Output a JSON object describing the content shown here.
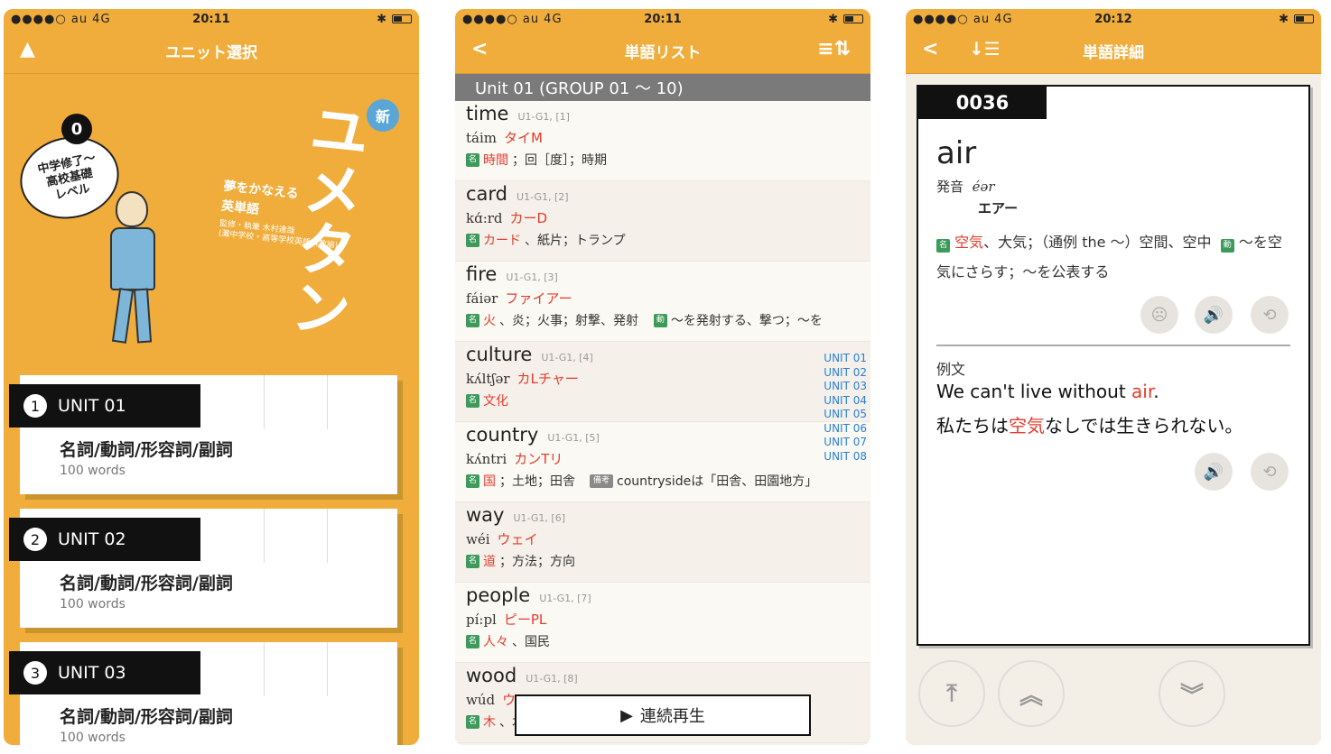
{
  "status": [
    {
      "carrier": "●●●●○ au  4G",
      "time": "20:11"
    },
    {
      "carrier": "●●●●○ au  4G",
      "time": "20:11"
    },
    {
      "carrier": "●●●●○ au  4G",
      "time": "20:12"
    }
  ],
  "screen1": {
    "nav_title": "ユニット選択",
    "bubble_text": "中学修了〜\n高校基礎\nレベル",
    "bubble_num": "0",
    "subtitle": "夢をかなえる\n英単語",
    "credit": "監修・執筆 木村達哉\n(灘中学校・高等学校英語科教諭)",
    "title": "ユメタン",
    "new_badge": "新",
    "units": [
      {
        "num": "1",
        "label": "UNIT 01",
        "title": "名詞/動詞/形容詞/副詞",
        "words": "100 words"
      },
      {
        "num": "2",
        "label": "UNIT 02",
        "title": "名詞/動詞/形容詞/副詞",
        "words": "100 words"
      },
      {
        "num": "3",
        "label": "UNIT 03",
        "title": "名詞/動詞/形容詞/副詞",
        "words": "100 words"
      }
    ]
  },
  "screen2": {
    "nav_title": "単語リスト",
    "unit_header": "Unit 01  (GROUP 01 〜 10)",
    "words": [
      {
        "word": "time",
        "code": "U1-G1, [1]",
        "ipa": "táim",
        "kana": "タイM",
        "pos": "名",
        "meaning_red": "時間",
        "meaning": "；回［度］；時期"
      },
      {
        "word": "card",
        "code": "U1-G1, [2]",
        "ipa": "kɑ́:rd",
        "kana": "カーD",
        "pos": "名",
        "meaning_red": "カード",
        "meaning": "、紙片；トランプ"
      },
      {
        "word": "fire",
        "code": "U1-G1, [3]",
        "ipa": "fáiər",
        "kana": "ファイアー",
        "pos": "名",
        "meaning_red": "火",
        "meaning": "、炎；火事；射撃、発射",
        "pos2": "動",
        "meaning2": "〜を発射する、撃つ；〜を"
      },
      {
        "word": "culture",
        "code": "U1-G1, [4]",
        "ipa": "kʌ́ltʃər",
        "kana": "カLチャー",
        "pos": "名",
        "meaning_red": "文化",
        "meaning": ""
      },
      {
        "word": "country",
        "code": "U1-G1, [5]",
        "ipa": "kʌ́ntri",
        "kana": "カンTリ",
        "pos": "名",
        "meaning_red": "国",
        "meaning": "；土地；田舎",
        "note_tag": "備考",
        "note": "countrysideは「田舎、田園地方」"
      },
      {
        "word": "way",
        "code": "U1-G1, [6]",
        "ipa": "wéi",
        "kana": "ウェイ",
        "pos": "名",
        "meaning_red": "道",
        "meaning": "；方法；方向"
      },
      {
        "word": "people",
        "code": "U1-G1, [7]",
        "ipa": "pí:pl",
        "kana": "ピーPL",
        "pos": "名",
        "meaning_red": "人々",
        "meaning": "、国民"
      },
      {
        "word": "wood",
        "code": "U1-G1, [8]",
        "ipa": "wúd",
        "kana": "ウD",
        "pos": "名",
        "meaning_red": "木",
        "meaning": "、木"
      }
    ],
    "index": [
      "UNIT 01",
      "UNIT 02",
      "UNIT 03",
      "UNIT 04",
      "UNIT 05",
      "UNIT 06",
      "UNIT 07",
      "UNIT 08"
    ],
    "play_label": "連続再生"
  },
  "screen3": {
    "nav_title": "単語詳細",
    "number": "0036",
    "word": "air",
    "pron_label": "発音",
    "ipa": "éər",
    "kana": "エアー",
    "pos": "名",
    "meaning_red": "空気",
    "meaning": "、大気；（通例 the 〜）空間、空中",
    "pos2": "動",
    "meaning2": "〜を空気にさらす；〜を公表する",
    "example_label": "例文",
    "example_en_pre": "We can't live without ",
    "example_en_red": "air",
    "example_en_post": ".",
    "example_jp_pre": "私たちは",
    "example_jp_red": "空気",
    "example_jp_post": "なしでは生きられない。"
  },
  "colors": {
    "accent": "#f0ad3c",
    "red": "#e43b2c",
    "green": "#3e9a5b",
    "blue": "#2b7fd4"
  }
}
